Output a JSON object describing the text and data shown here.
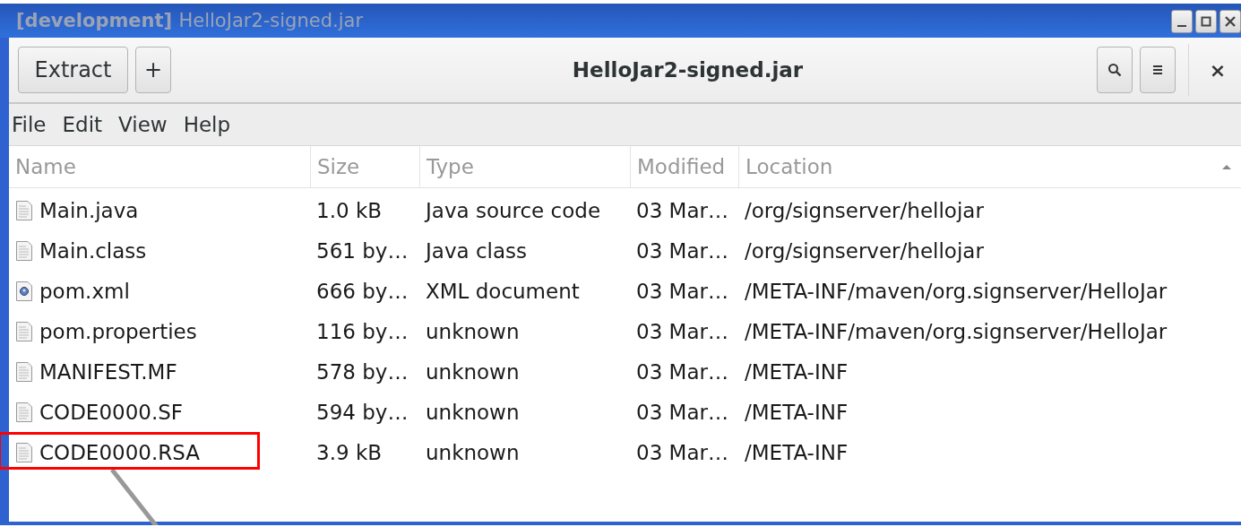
{
  "window": {
    "title_tag": "[development]",
    "title": "HelloJar2-signed.jar"
  },
  "header_bar": {
    "buttons": [
      "Extract",
      "+"
    ],
    "title": "HelloJar2-signed.jar",
    "close": "×"
  },
  "menu": [
    "File",
    "Edit",
    "View",
    "Help"
  ],
  "table": {
    "columns": [
      {
        "label": "Name",
        "sorted": false
      },
      {
        "label": "Size",
        "sorted": false
      },
      {
        "label": "Type",
        "sorted": false
      },
      {
        "label": "Modified",
        "sorted": false
      },
      {
        "label": "Location",
        "sorted": true
      }
    ],
    "rows": [
      {
        "kind": "text",
        "name": "Main.java",
        "size": "1.0 kB",
        "type": "Java source code",
        "modified": "03 Mar…",
        "location": "/org/signserver/hellojar",
        "highlighted": false
      },
      {
        "kind": "text",
        "name": "Main.class",
        "size": "561 by…",
        "type": "Java class",
        "modified": "03 Mar…",
        "location": "/org/signserver/hellojar",
        "highlighted": false
      },
      {
        "kind": "xml",
        "name": "pom.xml",
        "size": "666 by…",
        "type": "XML document",
        "modified": "03 Mar…",
        "location": "/META-INF/maven/org.signserver/HelloJar",
        "highlighted": false
      },
      {
        "kind": "text",
        "name": "pom.properties",
        "size": "116 by…",
        "type": "unknown",
        "modified": "03 Mar…",
        "location": "/META-INF/maven/org.signserver/HelloJar",
        "highlighted": false
      },
      {
        "kind": "text",
        "name": "MANIFEST.MF",
        "size": "578 by…",
        "type": "unknown",
        "modified": "03 Mar…",
        "location": "/META-INF",
        "highlighted": false
      },
      {
        "kind": "text",
        "name": "CODE0000.SF",
        "size": "594 by…",
        "type": "unknown",
        "modified": "03 Mar…",
        "location": "/META-INF",
        "highlighted": false
      },
      {
        "kind": "text",
        "name": "CODE0000.RSA",
        "size": "3.9 kB",
        "type": "unknown",
        "modified": "03 Mar…",
        "location": "/META-INF",
        "highlighted": true
      }
    ]
  }
}
